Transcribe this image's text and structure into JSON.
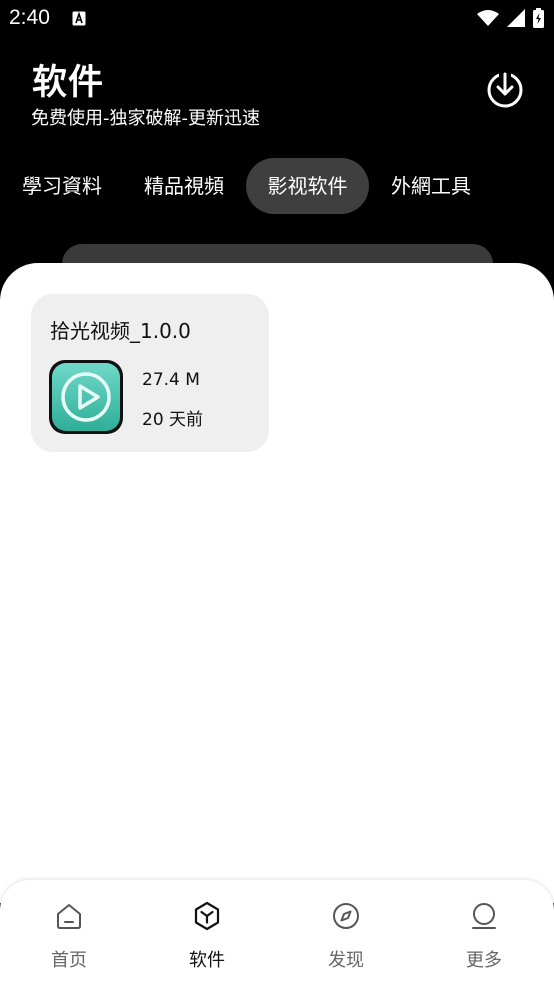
{
  "status_bar": {
    "time": "2:40"
  },
  "header": {
    "title": "软件",
    "subtitle": "免费使用-独家破解-更新迅速",
    "download_icon": "download-icon"
  },
  "tabs": [
    {
      "label": "學习資料",
      "active": false
    },
    {
      "label": "精品視頻",
      "active": false
    },
    {
      "label": "影视软件",
      "active": true
    },
    {
      "label": "外網工具",
      "active": false
    }
  ],
  "apps": [
    {
      "name": "拾光视频_1.0.0",
      "size": "27.4 M",
      "updated": "20 天前",
      "icon": "play-icon",
      "icon_colors": [
        "#6fd9c9",
        "#2fae98"
      ]
    }
  ],
  "bottom_nav": [
    {
      "label": "首页",
      "icon": "home-icon",
      "active": false
    },
    {
      "label": "软件",
      "icon": "software-icon",
      "active": true
    },
    {
      "label": "发现",
      "icon": "compass-icon",
      "active": false
    },
    {
      "label": "更多",
      "icon": "profile-icon",
      "active": false
    }
  ]
}
